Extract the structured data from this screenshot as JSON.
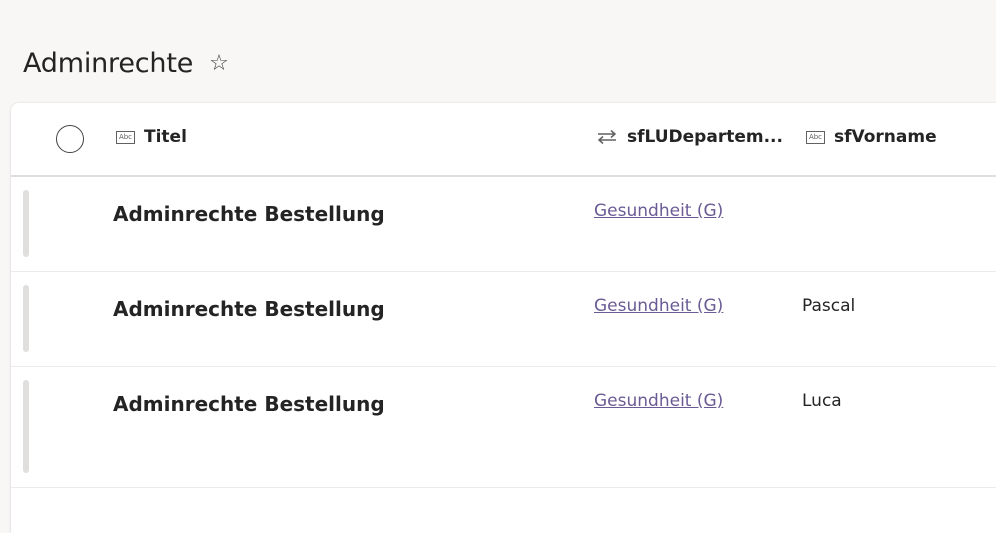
{
  "page": {
    "title": "Adminrechte",
    "favorite_icon": "star-outline-icon"
  },
  "list": {
    "columns": [
      {
        "label": "Titel",
        "icon": "text-field-icon"
      },
      {
        "label": "sfLUDepartem...",
        "icon": "lookup-arrows-icon"
      },
      {
        "label": "sfVorname",
        "icon": "text-field-icon"
      }
    ],
    "rows": [
      {
        "title": "Adminrechte Bestellung",
        "department": "Gesundheit (G)",
        "vorname": ""
      },
      {
        "title": "Adminrechte Bestellung",
        "department": "Gesundheit (G)",
        "vorname": "Pascal"
      },
      {
        "title": "Adminrechte Bestellung",
        "department": "Gesundheit (G)",
        "vorname": "Luca"
      }
    ]
  },
  "colors": {
    "link": "#6b5b95",
    "text": "#242424",
    "background": "#f8f7f6"
  }
}
